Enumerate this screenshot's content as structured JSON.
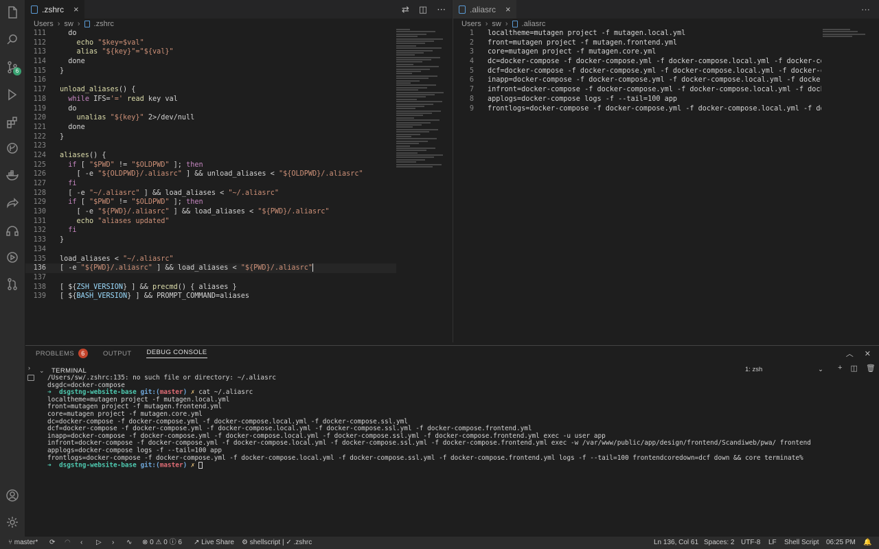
{
  "left_editor": {
    "tab_label": ".zshrc",
    "close_glyph": "×",
    "breadcrumb": [
      "Users",
      "sw",
      ".zshrc"
    ],
    "lines": [
      {
        "n": "111",
        "parts": [
          [
            "txt",
            "  do"
          ]
        ]
      },
      {
        "n": "112",
        "parts": [
          [
            "txt",
            "    "
          ],
          [
            "t-fn",
            "echo"
          ],
          [
            "txt",
            " "
          ],
          [
            "t-str",
            "\"$key=$val\""
          ]
        ]
      },
      {
        "n": "113",
        "parts": [
          [
            "txt",
            "    "
          ],
          [
            "t-fn",
            "alias"
          ],
          [
            "txt",
            " "
          ],
          [
            "t-str",
            "\"${key}\"=\"${val}\""
          ]
        ]
      },
      {
        "n": "114",
        "parts": [
          [
            "txt",
            "  done"
          ]
        ]
      },
      {
        "n": "115",
        "parts": [
          [
            "txt",
            "}"
          ]
        ]
      },
      {
        "n": "116",
        "parts": [
          [
            "txt",
            ""
          ]
        ]
      },
      {
        "n": "117",
        "parts": [
          [
            "t-fn",
            "unload_aliases"
          ],
          [
            "txt",
            "() {"
          ]
        ]
      },
      {
        "n": "118",
        "parts": [
          [
            "txt",
            "  "
          ],
          [
            "t-kw",
            "while"
          ],
          [
            "txt",
            " IFS="
          ],
          [
            "t-str",
            "'='"
          ],
          [
            "txt",
            " "
          ],
          [
            "t-fn",
            "read"
          ],
          [
            "txt",
            " key val"
          ]
        ]
      },
      {
        "n": "119",
        "parts": [
          [
            "txt",
            "  do"
          ]
        ]
      },
      {
        "n": "120",
        "parts": [
          [
            "txt",
            "    "
          ],
          [
            "t-fn",
            "unalias"
          ],
          [
            "txt",
            " "
          ],
          [
            "t-str",
            "\"${key}\""
          ],
          [
            "txt",
            " 2>/dev/null"
          ]
        ]
      },
      {
        "n": "121",
        "parts": [
          [
            "txt",
            "  done"
          ]
        ]
      },
      {
        "n": "122",
        "parts": [
          [
            "txt",
            "}"
          ]
        ]
      },
      {
        "n": "123",
        "parts": [
          [
            "txt",
            ""
          ]
        ]
      },
      {
        "n": "124",
        "parts": [
          [
            "t-fn",
            "aliases"
          ],
          [
            "txt",
            "() {"
          ]
        ]
      },
      {
        "n": "125",
        "parts": [
          [
            "txt",
            "  "
          ],
          [
            "t-kw",
            "if"
          ],
          [
            "txt",
            " [ "
          ],
          [
            "t-str",
            "\"$PWD\""
          ],
          [
            "txt",
            " != "
          ],
          [
            "t-str",
            "\"$OLDPWD\""
          ],
          [
            "txt",
            " ]; "
          ],
          [
            "t-kw",
            "then"
          ]
        ]
      },
      {
        "n": "126",
        "parts": [
          [
            "txt",
            "    [ -e "
          ],
          [
            "t-str",
            "\"${OLDPWD}/.aliasrc\""
          ],
          [
            "txt",
            " ] && unload_aliases < "
          ],
          [
            "t-str",
            "\"${OLDPWD}/.aliasrc\""
          ]
        ]
      },
      {
        "n": "127",
        "parts": [
          [
            "txt",
            "  "
          ],
          [
            "t-kw",
            "fi"
          ]
        ]
      },
      {
        "n": "128",
        "parts": [
          [
            "txt",
            "  [ -e "
          ],
          [
            "t-str",
            "\"~/.aliasrc\""
          ],
          [
            "txt",
            " ] && load_aliases < "
          ],
          [
            "t-str",
            "\"~/.aliasrc\""
          ]
        ]
      },
      {
        "n": "129",
        "parts": [
          [
            "txt",
            "  "
          ],
          [
            "t-kw",
            "if"
          ],
          [
            "txt",
            " [ "
          ],
          [
            "t-str",
            "\"$PWD\""
          ],
          [
            "txt",
            " != "
          ],
          [
            "t-str",
            "\"$OLDPWD\""
          ],
          [
            "txt",
            " ]; "
          ],
          [
            "t-kw",
            "then"
          ]
        ]
      },
      {
        "n": "130",
        "parts": [
          [
            "txt",
            "    [ -e "
          ],
          [
            "t-str",
            "\"${PWD}/.aliasrc\""
          ],
          [
            "txt",
            " ] && load_aliases < "
          ],
          [
            "t-str",
            "\"${PWD}/.aliasrc\""
          ]
        ]
      },
      {
        "n": "131",
        "parts": [
          [
            "txt",
            "    "
          ],
          [
            "t-fn",
            "echo"
          ],
          [
            "txt",
            " "
          ],
          [
            "t-str",
            "\"aliases updated\""
          ]
        ]
      },
      {
        "n": "132",
        "parts": [
          [
            "txt",
            "  "
          ],
          [
            "t-kw",
            "fi"
          ]
        ]
      },
      {
        "n": "133",
        "parts": [
          [
            "txt",
            "}"
          ]
        ]
      },
      {
        "n": "134",
        "parts": [
          [
            "txt",
            ""
          ]
        ]
      },
      {
        "n": "135",
        "parts": [
          [
            "txt",
            "load_aliases < "
          ],
          [
            "t-str",
            "\"~/.aliasrc\""
          ]
        ]
      },
      {
        "n": "136",
        "parts": [
          [
            "txt",
            "[ -e "
          ],
          [
            "t-str",
            "\"${PWD}/.aliasrc\""
          ],
          [
            "txt",
            " ] && load_aliases < "
          ],
          [
            "t-str",
            "\"${PWD}/.aliasrc\""
          ]
        ],
        "current": true
      },
      {
        "n": "137",
        "parts": [
          [
            "txt",
            ""
          ]
        ]
      },
      {
        "n": "138",
        "parts": [
          [
            "txt",
            "[ ${"
          ],
          [
            "t-var",
            "ZSH_VERSION"
          ],
          [
            "txt",
            "} ] && "
          ],
          [
            "t-fn",
            "precmd"
          ],
          [
            "txt",
            "() { aliases }"
          ]
        ]
      },
      {
        "n": "139",
        "parts": [
          [
            "txt",
            "[ ${"
          ],
          [
            "t-var",
            "BASH_VERSION"
          ],
          [
            "txt",
            "} ] && PROMPT_COMMAND=aliases"
          ]
        ]
      }
    ]
  },
  "right_editor": {
    "tab_label": ".aliasrc",
    "close_glyph": "×",
    "more_glyph": "···",
    "breadcrumb": [
      "Users",
      "sw",
      ".aliasrc"
    ],
    "lines": [
      {
        "n": "1",
        "text": "localtheme=mutagen project -f mutagen.local.yml"
      },
      {
        "n": "2",
        "text": "front=mutagen project -f mutagen.frontend.yml"
      },
      {
        "n": "3",
        "text": "core=mutagen project -f mutagen.core.yml"
      },
      {
        "n": "4",
        "text": "dc=docker-compose -f docker-compose.yml -f docker-compose.local.yml -f docker-compose.ss"
      },
      {
        "n": "5",
        "text": "dcf=docker-compose -f docker-compose.yml -f docker-compose.local.yml -f docker-compose.s"
      },
      {
        "n": "6",
        "text": "inapp=docker-compose -f docker-compose.yml -f docker-compose.local.yml -f docker-compose."
      },
      {
        "n": "7",
        "text": "infront=docker-compose -f docker-compose.yml -f docker-compose.local.yml -f docker-compos"
      },
      {
        "n": "8",
        "text": "applogs=docker-compose logs -f --tail=100 app"
      },
      {
        "n": "9",
        "text": "frontlogs=docker-compose -f docker-compose.yml -f docker-compose.local.yml -f docker-comp"
      }
    ]
  },
  "panel": {
    "tabs": [
      {
        "label": "PROBLEMS",
        "badge": "6",
        "active": false
      },
      {
        "label": "OUTPUT",
        "active": false
      },
      {
        "label": "DEBUG CONSOLE",
        "active": true
      }
    ],
    "terminal_title": "TERMINAL",
    "terminal_select": "1: zsh",
    "terminal_lines": [
      {
        "text": "/Users/sw/.zshrc:135: no such file or directory: ~/.aliasrc"
      },
      {
        "text": "dsgdc=docker-compose"
      },
      {
        "prompt": true,
        "dir": "dsgstng-website-base",
        "git": "git:(",
        "branch": "master",
        "git_close": ")",
        "x": "✗",
        "cmd": " cat ~/.aliasrc"
      },
      {
        "text": "localtheme=mutagen project -f mutagen.local.yml"
      },
      {
        "text": "front=mutagen project -f mutagen.frontend.yml"
      },
      {
        "text": "core=mutagen project -f mutagen.core.yml"
      },
      {
        "text": "dc=docker-compose -f docker-compose.yml -f docker-compose.local.yml -f docker-compose.ssl.yml"
      },
      {
        "text": "dcf=docker-compose -f docker-compose.yml -f docker-compose.local.yml -f docker-compose.ssl.yml -f docker-compose.frontend.yml"
      },
      {
        "text": "inapp=docker-compose -f docker-compose.yml -f docker-compose.local.yml -f docker-compose.ssl.yml -f docker-compose.frontend.yml exec -u user app"
      },
      {
        "text": "infront=docker-compose -f docker-compose.yml -f docker-compose.local.yml -f docker-compose.ssl.yml -f docker-compose.frontend.yml exec -w /var/www/public/app/design/frontend/Scandiweb/pwa/ frontend"
      },
      {
        "text": "applogs=docker-compose logs -f --tail=100 app"
      },
      {
        "text": "frontlogs=docker-compose -f docker-compose.yml -f docker-compose.local.yml -f docker-compose.ssl.yml -f docker-compose.frontend.yml logs -f --tail=100 frontendcoredown=dcf down && core terminate%"
      },
      {
        "prompt": true,
        "dir": "dsgstng-website-base",
        "git": "git:(",
        "branch": "master",
        "git_close": ")",
        "x": "✗",
        "cmd": " ",
        "cursor": true
      }
    ]
  },
  "status_bar": {
    "branch": "master*",
    "errors": "0",
    "warnings": "0",
    "info": "6",
    "live_share": "Live Share",
    "shellscript": "shellscript | ✓ .zshrc",
    "position": "Ln 136, Col 61",
    "spaces": "Spaces: 2",
    "encoding": "UTF-8",
    "eol": "LF",
    "language": "Shell Script",
    "time": "06:25 PM"
  },
  "activity": {
    "scm_badge": "6",
    "icons": [
      "files-icon",
      "search-icon",
      "source-control-icon",
      "run-debug-icon",
      "extensions-icon",
      "git-graph-icon",
      "docker-icon",
      "live-share-icon",
      "headphones-icon",
      "run-icon",
      "pull-request-icon",
      "account-icon",
      "gear-icon"
    ]
  }
}
